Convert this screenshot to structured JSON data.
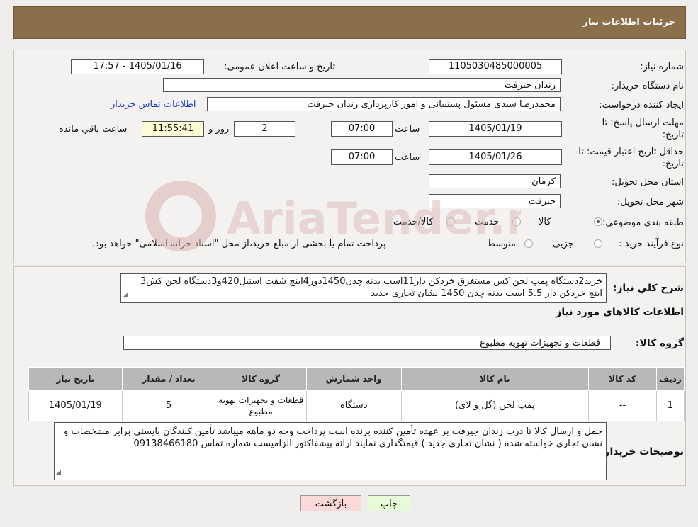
{
  "header": {
    "title": "جزئیات اطلاعات نیاز"
  },
  "form": {
    "need_number_label": "شماره نیاز:",
    "need_number": "1105030485000005",
    "announce_label": "تاریخ و ساعت اعلان عمومی:",
    "announce_value": "1405/01/16 - 17:57",
    "buyer_org_label": "نام دستگاه خریدار:",
    "buyer_org": "زندان جیرفت",
    "requester_label": "ایجاد کننده درخواست:",
    "requester": "محمدرضا سیدی مسئول پشتیبانی و امور کارپردازی زندان جیرفت",
    "contact_link": "اطلاعات تماس خریدار",
    "reply_deadline_label_1": "مهلت ارسال پاسخ: تا",
    "reply_deadline_label_2": "تاریخ:",
    "reply_date": "1405/01/19",
    "time_label": "ساعت",
    "reply_time": "07:00",
    "days_value": "2",
    "days_label": "روز و",
    "remaining_time": "11:55:41",
    "remaining_label": "ساعت باقي مانده",
    "price_valid_label_1": "حداقل تاریخ اعتبار قیمت: تا",
    "price_valid_label_2": "تاریخ:",
    "price_valid_date": "1405/01/26",
    "price_valid_time": "07:00",
    "province_label": "استان محل تحویل:",
    "province": "کرمان",
    "city_label": "شهر محل تحویل:",
    "city": "جیرفت",
    "category_label": "طبقه بندی موضوعی:",
    "category_options": [
      "کالا",
      "خدمت",
      "کالا/خدمت"
    ],
    "purchase_type_label": "نوع فرآیند خرید :",
    "purchase_options": [
      "جزیی",
      "متوسط"
    ],
    "purchase_note": "پرداخت تمام یا بخشی از مبلغ خرید،از محل \"اسناد خزانه اسلامی\" خواهد بود."
  },
  "description": {
    "label": "شرح کلي نياز:",
    "text": "خرید2دستگاه پمپ لجن کش مستغرق خردکن دار11اسب بدنه چدن1450دور4اینچ شفت استیل420و3دستگاه لجن کش3 اینچ خردکن دار 5.5 اسب بدنه چدن 1450 نشان تجاری جدید"
  },
  "goods": {
    "section_title": "اطلاعات کالاهای مورد نیاز",
    "group_label": "گروه کالا:",
    "group_value": "قطعات و تجهیزات تهویه مطبوع",
    "columns": [
      "ردیف",
      "کد کالا",
      "نام کالا",
      "واحد شمارش",
      "گروه کالا",
      "تعداد / مقدار",
      "تاریخ نیاز"
    ],
    "rows": [
      [
        "1",
        "--",
        "پمپ لجن (گل و لای)",
        "دستگاه",
        "قطعات و تجهیزات تهویه مطبوع",
        "5",
        "1405/01/19"
      ]
    ]
  },
  "buyer_notes": {
    "label": "توضیحات خریدار:",
    "text": "حمل و ارسال کالا تا درب زندان جیرفت بر عهده تأمین کننده برنده است پرداخت وجه دو ماهه میباشد تأمین کنندگان بایستی برابر مشخصات و نشان تجاری خواسته شده ( نشان تجاری جدید ) قیمتگذاری نمایند ارائه پیشفاکتور الزامیست شماره تماس 09138466180"
  },
  "buttons": {
    "print": "چاپ",
    "back": "بازگشت"
  },
  "colors": {
    "header_bg": "#8b6f4a",
    "print_bg": "#e8fbd8",
    "back_bg": "#fbd9d9"
  },
  "watermark": {
    "text": "AriaTender.neT"
  }
}
